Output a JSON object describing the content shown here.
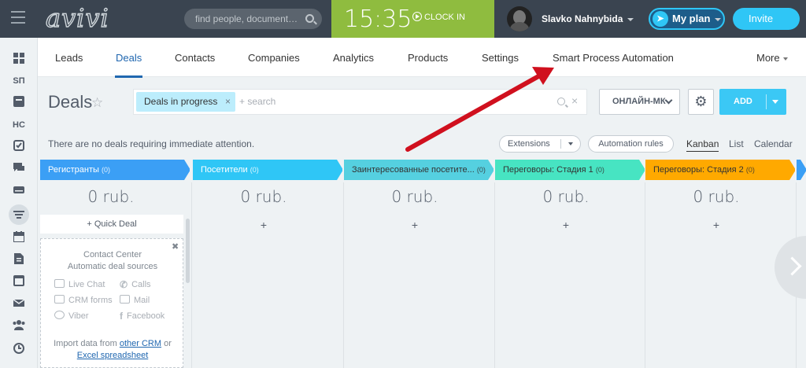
{
  "topbar": {
    "logo": "avivi",
    "search_placeholder": "find people, document…",
    "clock_time": "15:35",
    "clock_in_label": "CLOCK IN",
    "user_name": "Slavko Nahnybida",
    "my_plan_label": "My plan",
    "invite_label": "Invite"
  },
  "sidebar": {
    "items": [
      {
        "icon": "grid-icon"
      },
      {
        "icon": "sp-text",
        "label": "SП"
      },
      {
        "icon": "tasks-icon"
      },
      {
        "icon": "hc-text",
        "label": "НС"
      },
      {
        "icon": "checkbox-icon"
      },
      {
        "icon": "chat-icon"
      },
      {
        "icon": "drive-icon"
      },
      {
        "icon": "crm-funnel-icon"
      },
      {
        "icon": "calendar-icon"
      },
      {
        "icon": "document-icon"
      },
      {
        "icon": "window-icon"
      },
      {
        "icon": "mail-icon"
      },
      {
        "icon": "users-icon"
      },
      {
        "icon": "clock-icon"
      }
    ]
  },
  "nav": {
    "tabs": [
      {
        "label": "Leads"
      },
      {
        "label": "Deals",
        "active": true
      },
      {
        "label": "Contacts"
      },
      {
        "label": "Companies"
      },
      {
        "label": "Analytics"
      },
      {
        "label": "Products"
      },
      {
        "label": "Settings"
      },
      {
        "label": "Smart Process Automation"
      }
    ],
    "more_label": "More"
  },
  "toolbar": {
    "title": "Deals",
    "filter_chip": "Deals in progress",
    "search_placeholder": "+ search",
    "pipeline_label": "ОНЛАЙН-МК",
    "add_label": "ADD"
  },
  "info": {
    "notice": "There are no deals requiring immediate attention.",
    "extensions_label": "Extensions",
    "automation_label": "Automation rules",
    "views": [
      "Kanban",
      "List",
      "Calendar"
    ]
  },
  "kanban": {
    "columns": [
      {
        "title": "Регистранты",
        "count": "(0)",
        "color": "#3b9ff5",
        "amount": "0 rub."
      },
      {
        "title": "Посетители",
        "count": "(0)",
        "color": "#2fc6f6",
        "amount": "0 rub."
      },
      {
        "title": "Заинтересованные посетите...",
        "count": "(0)",
        "color": "#55d0e0",
        "amount": "0 rub."
      },
      {
        "title": "Переговоры: Стадия 1",
        "count": "(0)",
        "color": "#47e4c2",
        "amount": "0 rub."
      },
      {
        "title": "Переговоры: Стадия 2",
        "count": "(0)",
        "color": "#ffa900",
        "amount": "0 rub."
      }
    ],
    "quick_deal_label": "+ Quick Deal",
    "plus": "+"
  },
  "contact_center": {
    "title": "Contact Center",
    "subtitle": "Automatic deal sources",
    "sources": [
      "Live Chat",
      "Calls",
      "CRM forms",
      "Mail",
      "Viber",
      "Facebook"
    ],
    "import_prefix": "Import data from",
    "import_link1": "other CRM",
    "import_mid": "or",
    "import_link2": "Excel spreadsheet"
  },
  "colors": {
    "accent": "#2fc6f6",
    "clock_bg": "#8fbc3f",
    "topbar_bg": "#3a4450",
    "arrow": "#d0101e"
  }
}
